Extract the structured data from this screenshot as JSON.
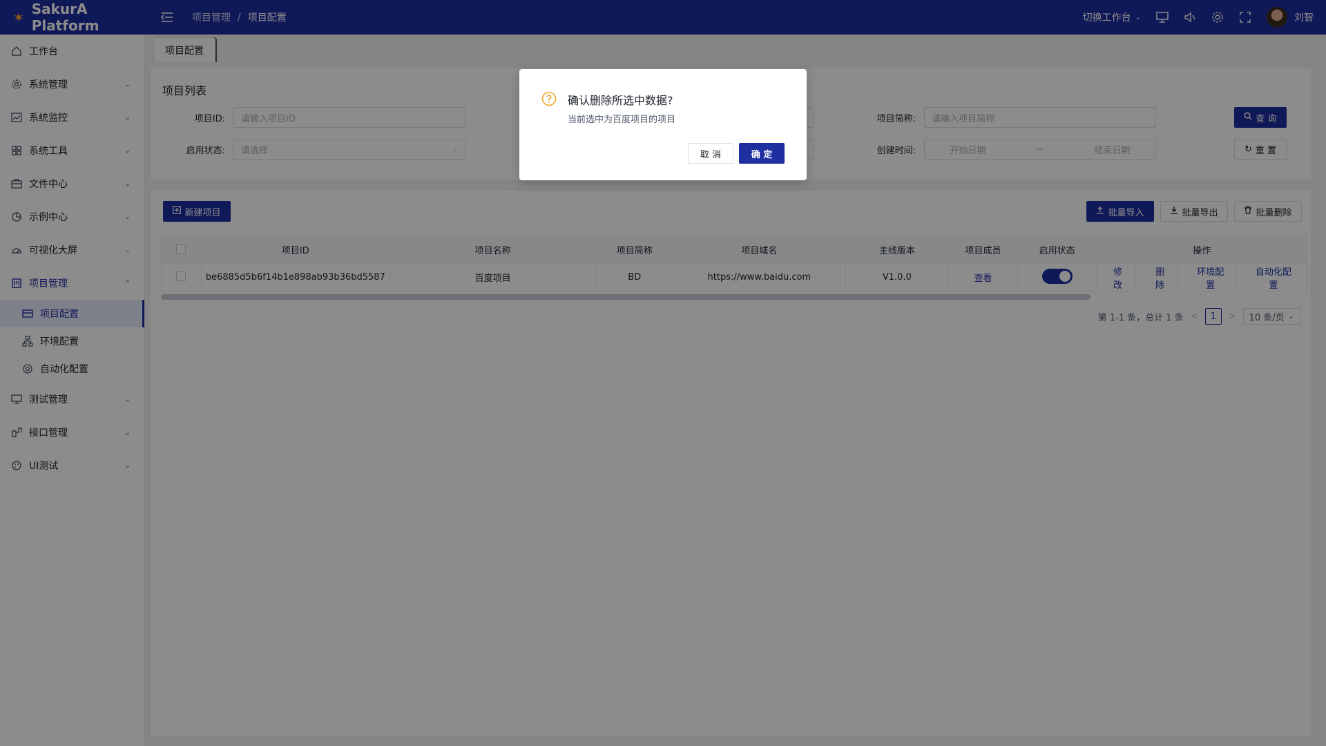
{
  "header": {
    "app_name": "SakurA Platform",
    "breadcrumb": [
      "项目管理",
      "/",
      "项目配置"
    ],
    "workspace_switch": "切换工作台",
    "user_name": "刘智",
    "colors": {
      "brand": "#1e2fa0"
    }
  },
  "sidebar": {
    "items": [
      {
        "label": "工作台",
        "icon": "home-icon"
      },
      {
        "label": "系统管理",
        "icon": "gear-icon"
      },
      {
        "label": "系统监控",
        "icon": "monitor-chart-icon"
      },
      {
        "label": "系统工具",
        "icon": "grid-icon"
      },
      {
        "label": "文件中心",
        "icon": "briefcase-icon"
      },
      {
        "label": "示例中心",
        "icon": "pie-icon"
      },
      {
        "label": "可视化大屏",
        "icon": "dashboard-icon"
      },
      {
        "label": "项目管理",
        "icon": "project-icon"
      },
      {
        "label": "测试管理",
        "icon": "screen-icon"
      },
      {
        "label": "接口管理",
        "icon": "api-icon"
      },
      {
        "label": "UI测试",
        "icon": "palette-icon"
      }
    ],
    "sub_items": [
      {
        "label": "项目配置",
        "icon": "card-icon"
      },
      {
        "label": "环境配置",
        "icon": "tree-icon"
      },
      {
        "label": "自动化配置",
        "icon": "automation-icon"
      }
    ]
  },
  "tabs": [
    {
      "label": "项目配置"
    }
  ],
  "search": {
    "title": "项目列表",
    "project_id_label": "项目ID:",
    "project_id_placeholder": "请输入项目ID",
    "project_abbr_label": "项目简称:",
    "project_abbr_placeholder": "请输入项目简称",
    "status_label": "启用状态:",
    "status_placeholder": "请选择",
    "created_label": "创建时间:",
    "start_date": "开始日期",
    "range_sep": "~",
    "end_date": "结束日期",
    "query_btn": "查 询",
    "reset_btn": "重 置"
  },
  "toolbar": {
    "new_btn": "新建项目",
    "import_btn": "批量导入",
    "export_btn": "批量导出",
    "delete_btn": "批量删除"
  },
  "table": {
    "headers": [
      "项目ID",
      "项目名称",
      "项目简称",
      "项目域名",
      "主线版本",
      "项目成员",
      "启用状态",
      "操作"
    ],
    "rows": [
      {
        "id": "be6885d5b6f14b1e898ab93b36bd5587",
        "name": "百度项目",
        "abbr": "BD",
        "domain": "https://www.baidu.com",
        "version": "V1.0.0",
        "members": "查看",
        "enabled": true,
        "ops": [
          "修改",
          "删除",
          "环境配置",
          "自动化配置"
        ]
      }
    ]
  },
  "pagination": {
    "summary": "第 1-1 条，总计 1 条",
    "current_page": "1",
    "page_size": "10 条/页",
    "prev": "<",
    "next": ">"
  },
  "dialog": {
    "title": "确认删除所选中数据?",
    "content": "当前选中为百度项目的项目",
    "cancel": "取 消",
    "ok": "确 定"
  }
}
